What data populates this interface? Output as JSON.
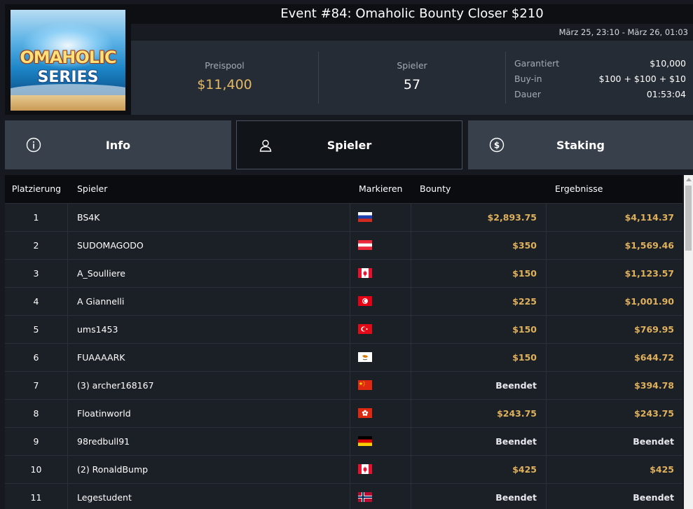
{
  "logo": {
    "title": "OMAHOLIC",
    "subtitle": "SERIES"
  },
  "event": {
    "title": "Event #84: Omaholic Bounty Closer $210",
    "dates": "März 25, 23:10 - März 26, 01:03"
  },
  "stats": {
    "prize_pool_label": "Preispool",
    "prize_pool_value": "$11,400",
    "players_label": "Spieler",
    "players_value": "57",
    "details": [
      {
        "key": "Garantiert",
        "value": "$10,000"
      },
      {
        "key": "Buy-in",
        "value": "$100 + $100 + $10"
      },
      {
        "key": "Dauer",
        "value": "01:53:04"
      }
    ]
  },
  "tabs": [
    {
      "label": "Info",
      "icon": "info-icon",
      "active": false
    },
    {
      "label": "Spieler",
      "icon": "user-icon",
      "active": true
    },
    {
      "label": "Staking",
      "icon": "staking-dollar-icon",
      "active": false
    }
  ],
  "table": {
    "headers": {
      "place": "Platzierung",
      "player": "Spieler",
      "flag": "Markieren",
      "bounty": "Bounty",
      "result": "Ergebnisse"
    },
    "rows": [
      {
        "place": "1",
        "player": "BS4K",
        "flag": "russia-flag",
        "bounty": "$2,893.75",
        "result": "$4,114.37"
      },
      {
        "place": "2",
        "player": "SUDOMAGODO",
        "flag": "austria-flag",
        "bounty": "$350",
        "result": "$1,569.46"
      },
      {
        "place": "3",
        "player": "A_Soulliere",
        "flag": "canada-flag",
        "bounty": "$150",
        "result": "$1,123.57"
      },
      {
        "place": "4",
        "player": "A Giannelli",
        "flag": "tunisia-flag",
        "bounty": "$225",
        "result": "$1,001.90"
      },
      {
        "place": "5",
        "player": "ums1453",
        "flag": "turkey-flag",
        "bounty": "$150",
        "result": "$769.95"
      },
      {
        "place": "6",
        "player": "FUAAAARK",
        "flag": "cyprus-flag",
        "bounty": "$150",
        "result": "$644.72"
      },
      {
        "place": "7",
        "player": "(3) archer168167",
        "flag": "china-flag",
        "bounty": "Beendet",
        "result": "$394.78"
      },
      {
        "place": "8",
        "player": "Floatinworld",
        "flag": "hong-kong-flag",
        "bounty": "$243.75",
        "result": "$243.75"
      },
      {
        "place": "9",
        "player": "98redbull91",
        "flag": "germany-flag",
        "bounty": "Beendet",
        "result": "Beendet"
      },
      {
        "place": "10",
        "player": "(2) RonaldBump",
        "flag": "canada-flag",
        "bounty": "$425",
        "result": "$425"
      },
      {
        "place": "11",
        "player": "Legestudent",
        "flag": "norway-flag",
        "bounty": "Beendet",
        "result": "Beendet"
      }
    ]
  },
  "colors": {
    "gold": "#e0b15c",
    "background": "#16191f",
    "panel": "#262c36",
    "tab": "#38404c",
    "tab_active": "#111419"
  }
}
